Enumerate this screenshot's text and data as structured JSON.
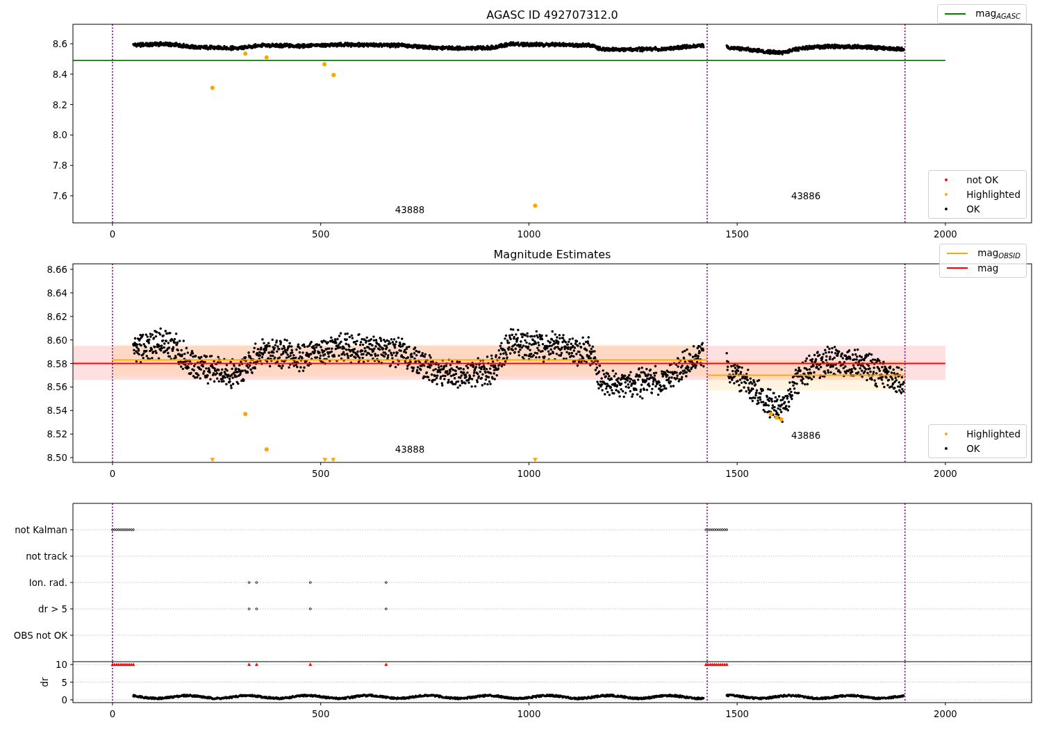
{
  "top": {
    "chart_data": {
      "type": "scatter",
      "title": "AGASC ID 492707312.0",
      "xlim": [
        -95,
        2207
      ],
      "ylim": [
        7.422,
        8.728
      ],
      "xticks": [
        0,
        500,
        1000,
        1500,
        2000
      ],
      "yticks": [
        7.6,
        7.8,
        {
          "value": 8,
          "label": "8.0"
        },
        8.2,
        8.4,
        8.6
      ],
      "series": [
        {
          "color": "#ffa500",
          "x": [
            240,
            319,
            370,
            509,
            531,
            1015
          ],
          "values": [
            8.31,
            8.535,
            8.51,
            8.465,
            8.395,
            7.535
          ]
        }
      ],
      "ref_lines": [
        {
          "axis": "y",
          "value": 8.49,
          "color": "#008000"
        },
        {
          "axis": "x",
          "value": 0,
          "color": "#800080"
        },
        {
          "axis": "x",
          "value": 1428,
          "color": "#800080"
        },
        {
          "axis": "x",
          "value": 1903,
          "color": "#800080"
        }
      ],
      "annotations": [
        "43888",
        "43886"
      ]
    },
    "legends": [
      {
        "entries": [
          {
            "kind": "line",
            "label": "mag$_{AGASC}$",
            "color": "#008000"
          }
        ]
      },
      {
        "entries": [
          {
            "kind": "dot",
            "label": "not OK",
            "color": "#ff0000"
          },
          {
            "kind": "dot",
            "label": "Highlighted",
            "color": "#ffa500"
          },
          {
            "kind": "dot",
            "label": "OK",
            "color": "#000000"
          }
        ]
      }
    ]
  },
  "middle": {
    "chart_data": {
      "type": "scatter",
      "title": "Magnitude Estimates",
      "xlim": [
        -95,
        2207
      ],
      "ylim": [
        8.4959,
        8.6647
      ],
      "xticks": [
        0,
        500,
        1000,
        1500,
        2000
      ],
      "yticks": [
        {
          "value": 8.5,
          "label": "8.50"
        },
        8.52,
        8.54,
        8.56,
        8.58,
        {
          "value": 8.6,
          "label": "8.60"
        },
        8.62,
        8.64,
        8.66
      ],
      "series": [
        {
          "color": "#ffa500",
          "x": [
            319,
            370,
            1581,
            1595,
            1606,
            240,
            510,
            530,
            1015
          ],
          "values": [
            8.537,
            8.507,
            8.537,
            8.534,
            8.5325,
            8.498,
            8.498,
            8.498,
            8.498
          ]
        }
      ],
      "bands": [
        {
          "axis": "y",
          "from": 8.566,
          "to": 8.595,
          "color": "#ff0000"
        },
        {
          "axis": "y",
          "from": 8.569,
          "to": 8.596,
          "color": "#ffa500"
        },
        {
          "axis": "y",
          "from": 8.557,
          "to": 8.583,
          "color": "#ffa500"
        }
      ],
      "ref_lines": [
        {
          "axis": "y",
          "value": 8.583,
          "color": "#ffa500"
        },
        {
          "axis": "y",
          "value": 8.57,
          "color": "#ffa500"
        },
        {
          "axis": "y",
          "value": 8.58,
          "color": "#ff0000"
        },
        {
          "axis": "x",
          "value": 0,
          "color": "#800080"
        },
        {
          "axis": "x",
          "value": 1428,
          "color": "#800080"
        },
        {
          "axis": "x",
          "value": 1903,
          "color": "#800080"
        }
      ],
      "annotations": [
        "43888",
        "43886"
      ]
    },
    "legends": [
      {
        "entries": [
          {
            "kind": "line",
            "label": "mag$_{OBSID}$",
            "color": "#ffa500"
          },
          {
            "kind": "line",
            "label": "mag",
            "color": "#ff0000"
          }
        ]
      },
      {
        "entries": [
          {
            "kind": "dot",
            "label": "Highlighted",
            "color": "#ffa500"
          },
          {
            "kind": "dot",
            "label": "OK",
            "color": "#000000"
          }
        ]
      }
    ]
  },
  "flags": {
    "labels": [
      "not Kalman",
      "not track",
      "Ion. rad.",
      "dr > 5",
      "OBS not OK"
    ]
  },
  "dr": {
    "chart_data": {
      "type": "scatter",
      "ylabel": "dr",
      "xlim": [
        -95,
        2207
      ],
      "ylim": [
        -0.8,
        10.8
      ],
      "xticks": [
        0,
        500,
        1000,
        1500,
        2000
      ],
      "yticks": [
        0,
        5,
        10
      ],
      "grid": true,
      "series": [
        {
          "color": "#ff0000",
          "x": [
            0,
            5,
            10,
            15,
            20,
            25,
            30,
            35,
            40,
            45,
            50,
            328,
            346,
            475,
            657,
            1425,
            1430,
            1435,
            1440,
            1445,
            1450,
            1455,
            1460,
            1465,
            1470,
            1475
          ],
          "values": [
            10,
            10,
            10,
            10,
            10,
            10,
            10,
            10,
            10,
            10,
            10,
            10,
            10,
            10,
            10,
            10,
            10,
            10,
            10,
            10,
            10,
            10,
            10,
            10,
            10,
            10
          ]
        }
      ],
      "ref_lines": [
        {
          "axis": "x",
          "value": 0,
          "color": "#800080"
        },
        {
          "axis": "x",
          "value": 1428,
          "color": "#800080"
        },
        {
          "axis": "x",
          "value": 1903,
          "color": "#800080"
        }
      ]
    }
  }
}
